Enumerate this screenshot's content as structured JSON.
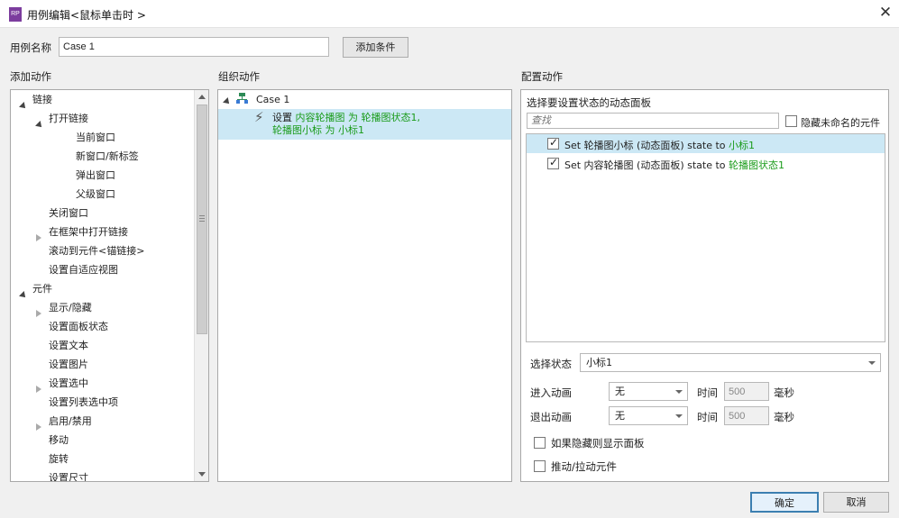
{
  "window": {
    "title": "用例编辑<鼠标单击时 >",
    "app_icon_text": "RP"
  },
  "case": {
    "name_label": "用例名称",
    "name_value": "Case 1",
    "add_condition_label": "添加条件"
  },
  "add_action": {
    "title": "添加动作",
    "items": [
      {
        "label": "链接",
        "level": 0,
        "twisty": "down"
      },
      {
        "label": "打开链接",
        "level": 1,
        "twisty": "down"
      },
      {
        "label": "当前窗口",
        "level": 2,
        "twisty": ""
      },
      {
        "label": "新窗口/新标签",
        "level": 2,
        "twisty": ""
      },
      {
        "label": "弹出窗口",
        "level": 2,
        "twisty": ""
      },
      {
        "label": "父级窗口",
        "level": 2,
        "twisty": ""
      },
      {
        "label": "关闭窗口",
        "level": 1,
        "twisty": ""
      },
      {
        "label": "在框架中打开链接",
        "level": 1,
        "twisty": "right"
      },
      {
        "label": "滚动到元件<锚链接>",
        "level": 1,
        "twisty": ""
      },
      {
        "label": "设置自适应视图",
        "level": 1,
        "twisty": ""
      },
      {
        "label": "元件",
        "level": 0,
        "twisty": "down"
      },
      {
        "label": "显示/隐藏",
        "level": 1,
        "twisty": "right"
      },
      {
        "label": "设置面板状态",
        "level": 1,
        "twisty": ""
      },
      {
        "label": "设置文本",
        "level": 1,
        "twisty": ""
      },
      {
        "label": "设置图片",
        "level": 1,
        "twisty": ""
      },
      {
        "label": "设置选中",
        "level": 1,
        "twisty": "right"
      },
      {
        "label": "设置列表选中项",
        "level": 1,
        "twisty": ""
      },
      {
        "label": "启用/禁用",
        "level": 1,
        "twisty": "right"
      },
      {
        "label": "移动",
        "level": 1,
        "twisty": ""
      },
      {
        "label": "旋转",
        "level": 1,
        "twisty": ""
      },
      {
        "label": "设置尺寸",
        "level": 1,
        "twisty": ""
      }
    ]
  },
  "organize": {
    "title": "组织动作",
    "case_label": "Case 1",
    "action_prefix": "设置",
    "action_green1": "内容轮播图 为 轮播图状态1,",
    "action_green2": "轮播图小标 为 小标1"
  },
  "configure": {
    "title": "配置动作",
    "subtitle": "选择要设置状态的动态面板",
    "search_placeholder": "查找",
    "hide_unnamed_label": "隐藏未命名的元件",
    "rows": [
      {
        "prefix": "Set 轮播图小标 (动态面板) state to ",
        "state": "小标1",
        "checked": true
      },
      {
        "prefix": "Set 内容轮播图 (动态面板) state to ",
        "state": "轮播图状态1",
        "checked": true
      }
    ],
    "select_state_label": "选择状态",
    "select_state_value": "小标1",
    "enter_anim_label": "进入动画",
    "enter_anim_value": "无",
    "exit_anim_label": "退出动画",
    "exit_anim_value": "无",
    "time_label": "时间",
    "time_value": "500",
    "ms_label": "毫秒",
    "show_if_hidden_label": "如果隐藏则显示面板",
    "push_pull_label": "推动/拉动元件"
  },
  "footer": {
    "ok_label": "确定",
    "cancel_label": "取消"
  },
  "colors": {
    "accent": "#cce8f5",
    "green": "#1a9b1a",
    "ok_border": "#3c7fb1"
  }
}
